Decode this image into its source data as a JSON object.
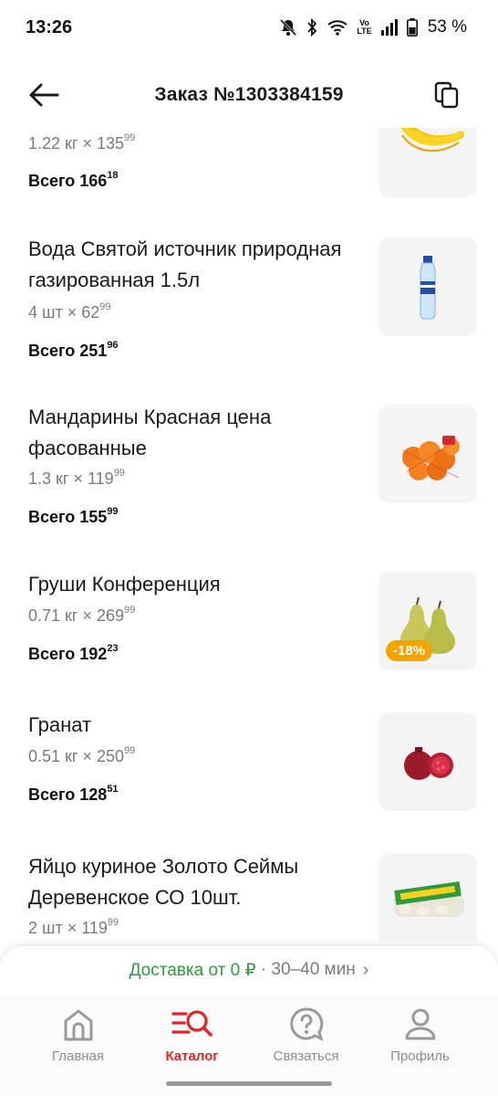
{
  "status_bar": {
    "time": "13:26",
    "volte_line1": "Vo",
    "volte_line2": "LTE",
    "battery_percent": "53 %"
  },
  "header": {
    "title": "Заказ №1303384159"
  },
  "items": [
    {
      "name": "",
      "qty": "1.22 кг × 135",
      "qty_cents": "99",
      "total_label": "Всего 166",
      "total_cents": "18",
      "image": "banana-image",
      "discount": ""
    },
    {
      "name": "Вода Святой источник природная газированная 1.5л",
      "qty": "4 шт × 62",
      "qty_cents": "99",
      "total_label": "Всего 251",
      "total_cents": "96",
      "image": "water-bottle-image",
      "discount": ""
    },
    {
      "name": "Мандарины Красная цена фасованные",
      "qty": "1.3 кг × 119",
      "qty_cents": "99",
      "total_label": "Всего 155",
      "total_cents": "99",
      "image": "mandarins-image",
      "discount": ""
    },
    {
      "name": "Груши Конференция",
      "qty": "0.71 кг × 269",
      "qty_cents": "99",
      "total_label": "Всего 192",
      "total_cents": "23",
      "image": "pears-image",
      "discount": "-18%"
    },
    {
      "name": "Гранат",
      "qty": "0.51 кг × 250",
      "qty_cents": "99",
      "total_label": "Всего 128",
      "total_cents": "51",
      "image": "pomegranate-image",
      "discount": ""
    },
    {
      "name": "Яйцо куриное Золото Сеймы Деревенское СО 10шт.",
      "qty": "2 шт × 119",
      "qty_cents": "99",
      "total_label": "",
      "total_cents": "",
      "image": "eggs-image",
      "discount": ""
    }
  ],
  "delivery": {
    "text": "Доставка от 0 ₽",
    "separator": " · ",
    "time": "30–40 мин",
    "chevron": "›"
  },
  "nav": [
    {
      "label": "Главная",
      "icon": "home-icon"
    },
    {
      "label": "Каталог",
      "icon": "catalog-search-icon",
      "active": true
    },
    {
      "label": "Связаться",
      "icon": "help-chat-icon"
    },
    {
      "label": "Профиль",
      "icon": "profile-icon"
    }
  ],
  "colors": {
    "accent": "#e0262c",
    "delivery_green": "#2e9a3e",
    "discount_badge": "#f7a400",
    "muted_text": "#7a7a7a"
  }
}
